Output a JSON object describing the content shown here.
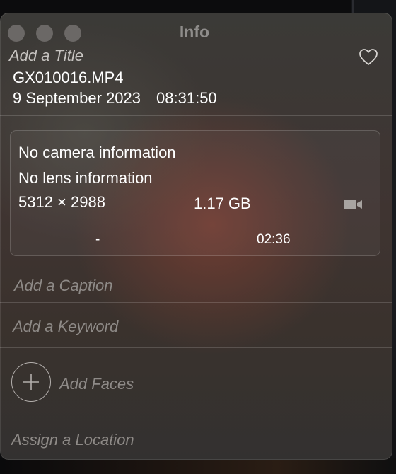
{
  "window": {
    "title": "Info"
  },
  "header": {
    "title_placeholder": "Add a Title",
    "filename": "GX010016.MP4",
    "date": "9 September 2023",
    "time": "08:31:50"
  },
  "details": {
    "camera": "No camera information",
    "lens": "No lens information",
    "dimensions": "5312 × 2988",
    "file_size": "1.17 GB",
    "media_type_icon": "video-camera-icon",
    "footer_left": "-",
    "duration": "02:36"
  },
  "fields": {
    "caption_placeholder": "Add a Caption",
    "keyword_placeholder": "Add a Keyword",
    "faces_label": "Add Faces",
    "location_placeholder": "Assign a Location"
  },
  "icons": {
    "favorite": "heart-icon",
    "add_faces": "plus-circle-icon"
  },
  "colors": {
    "text_primary": "#ffffff",
    "placeholder": "#8e8a87",
    "traffic_light": "#6b6866"
  }
}
